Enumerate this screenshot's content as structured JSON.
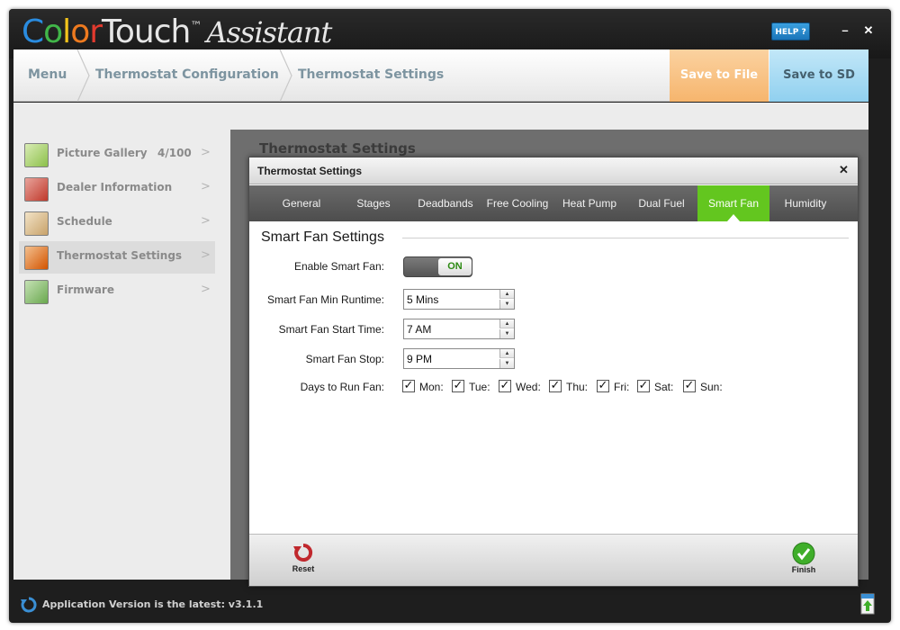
{
  "app": {
    "logo_parts": [
      {
        "text": "C",
        "color": "#2a8ce0"
      },
      {
        "text": "o",
        "color": "#41b649"
      },
      {
        "text": "l",
        "color": "#f2c31b"
      },
      {
        "text": "o",
        "color": "#ee7a1f"
      },
      {
        "text": "r",
        "color": "#e23a2e"
      },
      {
        "text": "Touch",
        "color": "#e6e6e6"
      }
    ],
    "logo_tm": "™",
    "logo_subtitle": "Assistant",
    "help_label": "HELP ?",
    "minimize_label": "–",
    "close_label": "✕"
  },
  "breadcrumb": {
    "items": [
      "Menu",
      "Thermostat Configuration",
      "Thermostat Settings"
    ]
  },
  "actions": {
    "save_file_label": "Save to File",
    "save_sd_label": "Save to SD"
  },
  "sidebar": {
    "items": [
      {
        "label": "Picture Gallery",
        "count": "4/100",
        "icon": "picture-gallery-icon",
        "color": "#8cc04a",
        "active": false
      },
      {
        "label": "Dealer Information",
        "count": "",
        "icon": "briefcase-icon",
        "color": "#c0392b",
        "active": false
      },
      {
        "label": "Schedule",
        "count": "",
        "icon": "calendar-icon",
        "color": "#c8a26a",
        "active": false
      },
      {
        "label": "Thermostat Settings",
        "count": "",
        "icon": "thermostat-icon",
        "color": "#d35400",
        "active": true
      },
      {
        "label": "Firmware",
        "count": "",
        "icon": "chip-icon",
        "color": "#6aa84f",
        "active": false
      }
    ],
    "chevron": ">"
  },
  "background_panel": {
    "title": "Thermostat Settings"
  },
  "dialog": {
    "title": "Thermostat Settings",
    "close_label": "✕",
    "tabs": [
      {
        "label": "General",
        "active": false
      },
      {
        "label": "Stages",
        "active": false
      },
      {
        "label": "Deadbands",
        "active": false
      },
      {
        "label": "Free Cooling",
        "active": false
      },
      {
        "label": "Heat Pump",
        "active": false
      },
      {
        "label": "Dual Fuel",
        "active": false
      },
      {
        "label": "Smart Fan",
        "active": true
      },
      {
        "label": "Humidity",
        "active": false
      }
    ],
    "section_title": "Smart Fan Settings",
    "enable_label": "Enable Smart Fan:",
    "toggle_state": "ON",
    "min_runtime_label": "Smart Fan Min Runtime:",
    "min_runtime_value": "5 Mins",
    "start_time_label": "Smart Fan Start Time:",
    "start_time_value": "7 AM",
    "stop_label": "Smart Fan Stop:",
    "stop_value": "9 PM",
    "days_label": "Days to Run Fan:",
    "days": [
      {
        "label": "Mon:",
        "checked": true
      },
      {
        "label": "Tue:",
        "checked": true
      },
      {
        "label": "Wed:",
        "checked": true
      },
      {
        "label": "Thu:",
        "checked": true
      },
      {
        "label": "Fri:",
        "checked": true
      },
      {
        "label": "Sat:",
        "checked": true
      },
      {
        "label": "Sun:",
        "checked": true
      }
    ],
    "reset_label": "Reset",
    "finish_label": "Finish"
  },
  "status": {
    "text": "Application Version is the latest: v3.1.1"
  },
  "colors": {
    "active_tab": "#63c61f",
    "save_file": "#f6b56d",
    "save_sd": "#90d0ef",
    "accent_text": "#7d94a0"
  }
}
